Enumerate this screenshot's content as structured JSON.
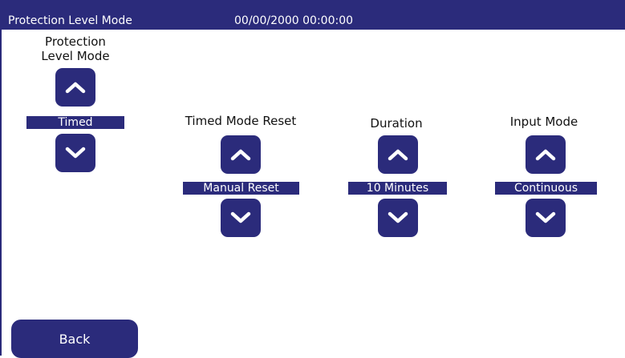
{
  "header": {
    "title": "Protection Level Mode",
    "datetime": "00/00/2000 00:00:00"
  },
  "controls": {
    "protection_level_mode": {
      "label_line1": "Protection",
      "label_line2": "Level Mode",
      "value": "Timed"
    },
    "timed_mode_reset": {
      "label": "Timed Mode Reset",
      "value": "Manual Reset"
    },
    "duration": {
      "label": "Duration",
      "value": "10 Minutes"
    },
    "input_mode": {
      "label": "Input Mode",
      "value": "Continuous"
    }
  },
  "footer": {
    "back_label": "Back"
  },
  "icons": {
    "up": "chevron-up-icon",
    "down": "chevron-down-icon"
  },
  "colors": {
    "accent": "#2b2b7b",
    "background": "#ffffff",
    "text_on_accent": "#ffffff"
  }
}
